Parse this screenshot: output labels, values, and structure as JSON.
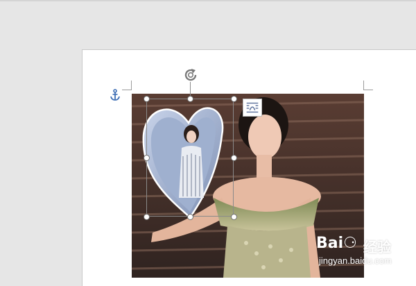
{
  "watermark": {
    "logo": "Bai⚆",
    "chinese": "经验",
    "url": "jingyan.baidu.com"
  },
  "icons": {
    "anchor": "anchor-icon",
    "rotate": "rotate-handle-icon",
    "layout_options": "layout-options-icon"
  },
  "colors": {
    "workspace": "#e6e6e6",
    "page": "#ffffff",
    "anchor": "#3f6fb5",
    "handle_border": "#6f6f6f"
  }
}
